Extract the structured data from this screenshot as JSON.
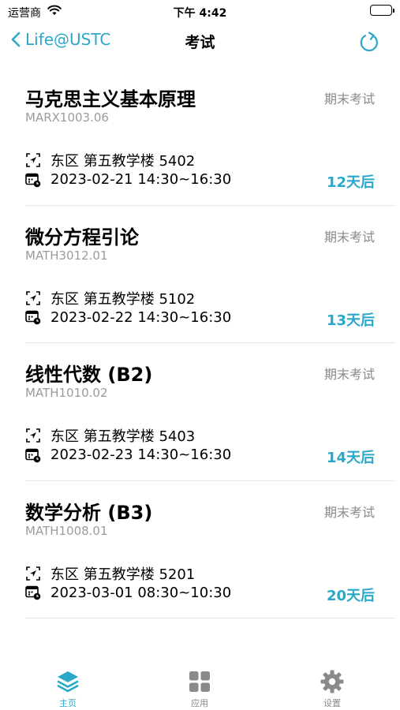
{
  "status_bar": {
    "carrier": "运营商",
    "time": "下午 4:42"
  },
  "nav": {
    "back_label": "Life@USTC",
    "title": "考试"
  },
  "exams": [
    {
      "name": "马克思主义基本原理",
      "code": "MARX1003.06",
      "type": "期末考试",
      "location": "东区 第五教学楼 5402",
      "time": "2023-02-21 14:30~16:30",
      "countdown": "12天后"
    },
    {
      "name": "微分方程引论",
      "code": "MATH3012.01",
      "type": "期末考试",
      "location": "东区 第五教学楼 5102",
      "time": "2023-02-22 14:30~16:30",
      "countdown": "13天后"
    },
    {
      "name": "线性代数 (B2)",
      "code": "MATH1010.02",
      "type": "期末考试",
      "location": "东区 第五教学楼 5403",
      "time": "2023-02-23 14:30~16:30",
      "countdown": "14天后"
    },
    {
      "name": "数学分析 (B3)",
      "code": "MATH1008.01",
      "type": "期末考试",
      "location": "东区 第五教学楼 5201",
      "time": "2023-03-01 08:30~10:30",
      "countdown": "20天后"
    }
  ],
  "tabs": [
    {
      "label": "主页",
      "icon": "stack-icon",
      "active": true
    },
    {
      "label": "应用",
      "icon": "grid-icon",
      "active": false
    },
    {
      "label": "设置",
      "icon": "gear-icon",
      "active": false
    }
  ],
  "colors": {
    "accent": "#2aa7c9",
    "secondary_text": "#8a8a8a",
    "divider": "#e3e3e3"
  }
}
